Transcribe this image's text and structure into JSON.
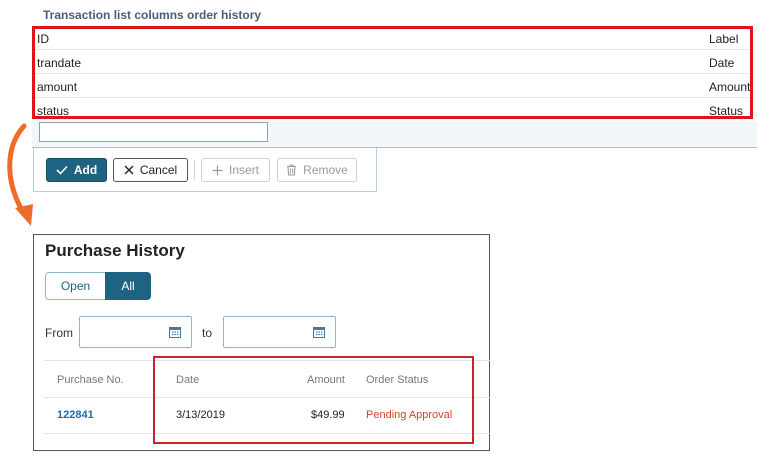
{
  "section": {
    "title": "Transaction list columns order history"
  },
  "columns_table": {
    "headers": [
      "ID",
      "Label"
    ],
    "rows": [
      [
        "trandate",
        "Date"
      ],
      [
        "amount",
        "Amount"
      ],
      [
        "status",
        "Status"
      ]
    ]
  },
  "toolbar": {
    "add_label": "Add",
    "cancel_label": "Cancel",
    "insert_label": "Insert",
    "remove_label": "Remove"
  },
  "purchase_history": {
    "title": "Purchase History",
    "filter": {
      "open_label": "Open",
      "all_label": "All",
      "selected": "All"
    },
    "date_range": {
      "from_label": "From",
      "to_label": "to"
    },
    "headers": [
      "Purchase No.",
      "Date",
      "Amount",
      "Order Status"
    ],
    "rows": [
      {
        "number": "122841",
        "date": "3/13/2019",
        "amount": "$49.99",
        "status": "Pending Approval"
      }
    ]
  },
  "colors": {
    "accent": "#1e6382",
    "highlight_border": "#e0141e",
    "status_pending": "#d2442a",
    "link": "#1e6fb0"
  },
  "icons": [
    "check-icon",
    "close-icon",
    "plus-icon",
    "trash-icon",
    "calendar-icon",
    "curved-arrow-icon"
  ]
}
